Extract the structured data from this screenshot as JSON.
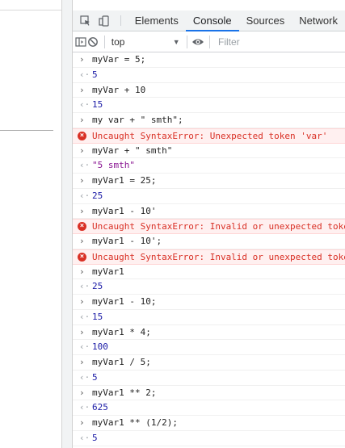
{
  "tabs": [
    "Elements",
    "Console",
    "Sources",
    "Network"
  ],
  "active_tab": "Console",
  "toolbar": {
    "context": "top",
    "filter_placeholder": "Filter"
  },
  "console": [
    {
      "type": "input",
      "text": "myVar = 5;"
    },
    {
      "type": "result",
      "text": "5"
    },
    {
      "type": "input",
      "text": "myVar + 10"
    },
    {
      "type": "result",
      "text": "15"
    },
    {
      "type": "input",
      "text": "my var + \" smth\";"
    },
    {
      "type": "error",
      "text": "Uncaught SyntaxError: Unexpected token 'var'"
    },
    {
      "type": "input",
      "text": "myVar + \" smth\""
    },
    {
      "type": "result",
      "text": "\"5 smth\""
    },
    {
      "type": "input",
      "text": "myVar1 = 25;"
    },
    {
      "type": "result",
      "text": "25"
    },
    {
      "type": "input",
      "text": "myVar1 - 10'"
    },
    {
      "type": "error",
      "text": "Uncaught SyntaxError: Invalid or unexpected token"
    },
    {
      "type": "input",
      "text": "myVar1 - 10';"
    },
    {
      "type": "error",
      "text": "Uncaught SyntaxError: Invalid or unexpected token"
    },
    {
      "type": "input",
      "text": "myVar1"
    },
    {
      "type": "result",
      "text": "25"
    },
    {
      "type": "input",
      "text": "myVar1 - 10;"
    },
    {
      "type": "result",
      "text": "15"
    },
    {
      "type": "input",
      "text": "myVar1 * 4;"
    },
    {
      "type": "result",
      "text": "100"
    },
    {
      "type": "input",
      "text": "myVar1 / 5;"
    },
    {
      "type": "result",
      "text": "5"
    },
    {
      "type": "input",
      "text": "myVar1 ** 2;"
    },
    {
      "type": "result",
      "text": "625"
    },
    {
      "type": "input",
      "text": "myVar1 ** (1/2);"
    },
    {
      "type": "result",
      "text": "5"
    }
  ],
  "colors": {
    "accent": "#1a73e8",
    "error": "#d93025",
    "error_bg": "#fff0f0",
    "number": "#1a1aa6"
  },
  "icons": {
    "inspect": "inspect-element-icon",
    "device": "device-toolbar-icon",
    "sidebar": "console-sidebar-icon",
    "clear": "clear-console-icon",
    "eye": "live-expression-icon"
  }
}
